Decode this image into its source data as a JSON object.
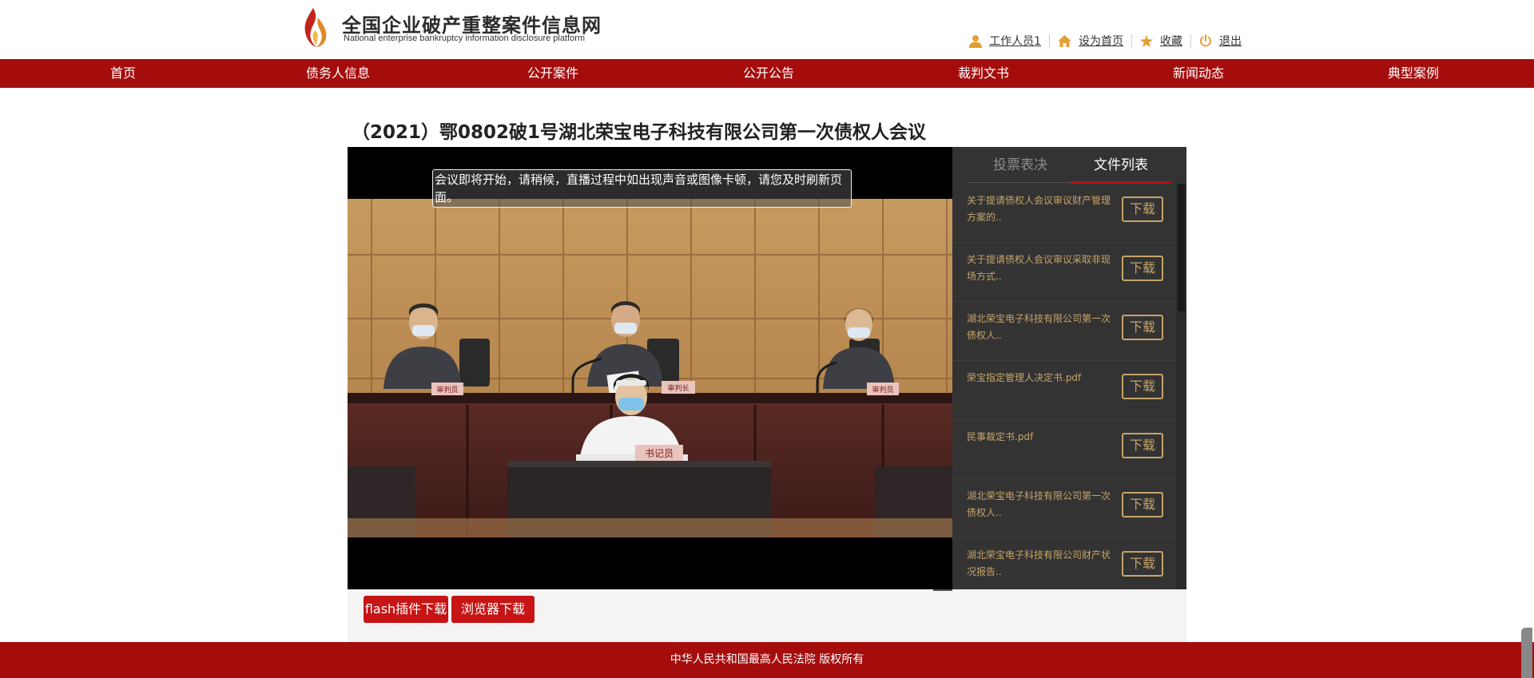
{
  "site": {
    "name_cn": "全国企业破产重整案件信息网",
    "name_en": "National enterprise bankruptcy  information disclosure platform"
  },
  "userbar": {
    "user": "工作人员1",
    "set_home": "设为首页",
    "favorite": "收藏",
    "logout": "退出"
  },
  "nav": [
    {
      "label": "首页"
    },
    {
      "label": "债务人信息"
    },
    {
      "label": "公开案件"
    },
    {
      "label": "公开公告"
    },
    {
      "label": "裁判文书"
    },
    {
      "label": "新闻动态"
    },
    {
      "label": "典型案例"
    }
  ],
  "meeting": {
    "title": "（2021）鄂0802破1号湖北荣宝电子科技有限公司第一次债权人会议",
    "notice": "会议即将开始，请稍候，直播过程中如出现声音或图像卡顿，请您及时刷新页面。"
  },
  "scene_labels": {
    "judge_left": "审判员",
    "judge_center": "审判长",
    "judge_right": "审判员",
    "clerk": "书记员"
  },
  "panel": {
    "tab_vote": "投票表决",
    "tab_files": "文件列表",
    "active_tab": "文件列表",
    "download_label": "下载",
    "files": [
      {
        "name": "关于提请债权人会议审议财产管理方案的.."
      },
      {
        "name": "关于提请债权人会议审议采取非现场方式.."
      },
      {
        "name": "湖北荣宝电子科技有限公司第一次债权人.."
      },
      {
        "name": "荣宝指定管理人决定书.pdf"
      },
      {
        "name": "民事裁定书.pdf"
      },
      {
        "name": "湖北荣宝电子科技有限公司第一次债权人.."
      },
      {
        "name": "湖北荣宝电子科技有限公司财产状况报告.."
      }
    ]
  },
  "buttons": {
    "flash": "flash插件下载",
    "browser": "浏览器下载"
  },
  "footer": {
    "copyright": "中华人民共和国最高人民法院 版权所有"
  },
  "colors": {
    "brand_red": "#a50d0d",
    "button_red": "#c71414",
    "gold": "#c6a46a",
    "panel_bg": "#333333"
  }
}
